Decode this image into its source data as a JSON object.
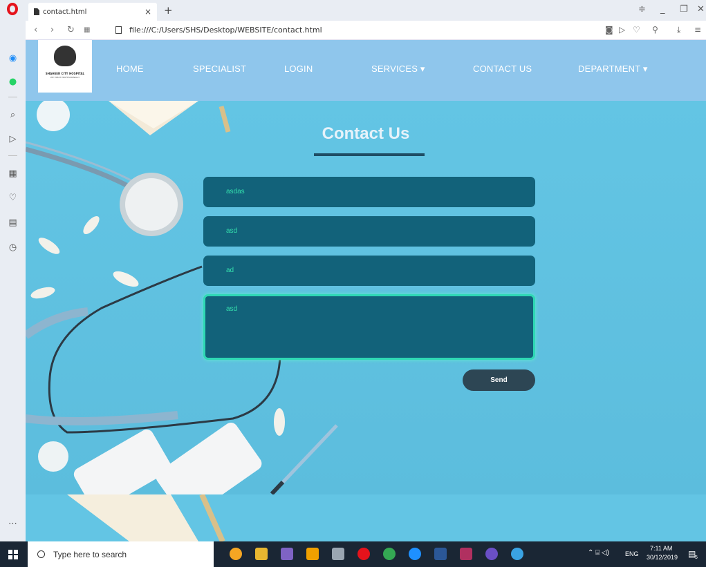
{
  "browser": {
    "tab_title": "contact.html",
    "tab_close": "×",
    "new_tab": "+",
    "url": "file:///C:/Users/SHS/Desktop/WEBSITE/contact.html"
  },
  "site": {
    "logo": {
      "name": "SHAHEER CITY HOSPITAL",
      "tagline": "WE TREAT PROFESSIONALLY"
    },
    "nav": [
      {
        "label": "HOME"
      },
      {
        "label": "SPECIALIST"
      },
      {
        "label": "LOGIN"
      },
      {
        "label": "SERVICES ▾"
      },
      {
        "label": "CONTACT US"
      },
      {
        "label": "DEPARTMENT ▾"
      }
    ],
    "title": "Contact Us",
    "form": {
      "name_value": "asdas",
      "email_value": "asd",
      "subject_value": "ad",
      "message_value": "asd",
      "send_label": "Send"
    }
  },
  "taskbar": {
    "search_placeholder": "Type here to search",
    "lang": "ENG",
    "time": "7:11 AM",
    "date": "30/12/2019",
    "notif_count": "5"
  },
  "colors": {
    "navbar": "#8fc6ec",
    "field_bg": "#12627a",
    "field_text": "#34e0ad",
    "send_bg": "#2d4654",
    "page_bg": "#5bbedf"
  }
}
